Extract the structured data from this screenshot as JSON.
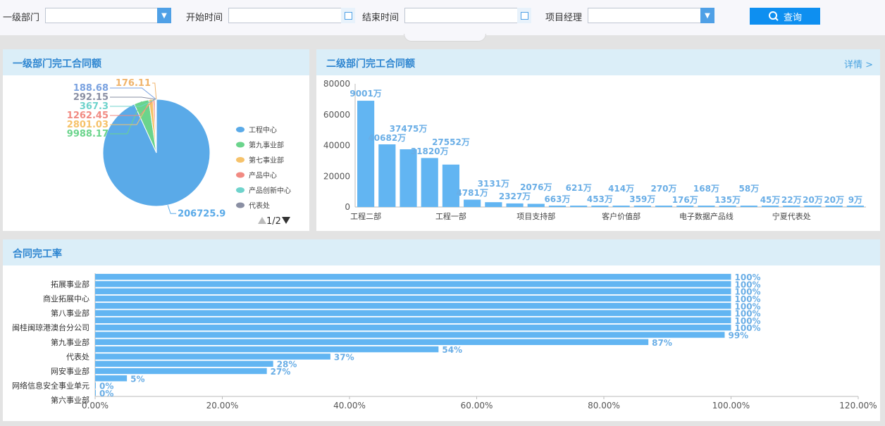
{
  "filters": {
    "dept_label": "一级部门",
    "start_label": "开始时间",
    "end_label": "结束时间",
    "pm_label": "项目经理",
    "search_label": "查询"
  },
  "panels": {
    "pie_title": "一级部门完工合同额",
    "bar_title": "二级部门完工合同额",
    "bar_detail": "详情 >",
    "rate_title": "合同完工率"
  },
  "colors": {
    "accent": "#0e8ff0",
    "pie_main": "#5aaae8",
    "bar": "#62b5f2",
    "header_bg": "#dbeef8"
  },
  "chart_data": [
    {
      "type": "pie",
      "title": "一级部门完工合同额",
      "slices": [
        {
          "label": "工程中心",
          "value": 206725.9,
          "color": "#5aaae8"
        },
        {
          "label": "第九事业部",
          "value": 9988.17,
          "color": "#6bd48c"
        },
        {
          "label": "第七事业部",
          "value": 2801.03,
          "color": "#f6c26a"
        },
        {
          "label": "产品中心",
          "value": 1262.45,
          "color": "#f18a82"
        },
        {
          "label": "产品创新中心",
          "value": 367.3,
          "color": "#6fd3cc"
        },
        {
          "label": "代表处",
          "value": 292.15,
          "color": "#8a8fa3"
        },
        {
          "label": "",
          "value": 188.68,
          "color": "#7aa2e0"
        },
        {
          "label": "",
          "value": 176.11,
          "color": "#f0b46c"
        }
      ],
      "value_labels": [
        "206725.9",
        "9988.17",
        "2801.03",
        "1262.45",
        "367.3",
        "292.15",
        "188.68",
        "176.11"
      ],
      "legend": [
        "工程中心",
        "第九事业部",
        "第七事业部",
        "产品中心",
        "产品创新中心",
        "代表处"
      ],
      "legend_page": "1/2"
    },
    {
      "type": "bar",
      "title": "二级部门完工合同额",
      "values": [
        69001,
        40682,
        37475,
        31820,
        27552,
        4781,
        3131,
        2327,
        2076,
        663,
        621,
        453,
        414,
        359,
        270,
        176,
        168,
        135,
        58,
        45,
        22,
        20,
        20,
        9
      ],
      "value_labels": [
        "9001万",
        "40682万",
        "37475万",
        "31820万",
        "27552万",
        "4781万",
        "3131万",
        "2327万",
        "2076万",
        "663万",
        "621万",
        "453万",
        "414万",
        "359万",
        "270万",
        "176万",
        "168万",
        "135万",
        "58万",
        "45万",
        "22万",
        "20万",
        "20万",
        "9万"
      ],
      "x_tick_labels": [
        "工程二部",
        "工程一部",
        "项目支持部",
        "客户价值部",
        "电子数据产品线",
        "宁夏代表处"
      ],
      "y_ticks": [
        "0",
        "20000",
        "40000",
        "60000",
        "80000"
      ],
      "ylim": [
        0,
        80000
      ]
    },
    {
      "type": "bar",
      "orientation": "horizontal",
      "title": "合同完工率",
      "values": [
        100,
        100,
        100,
        100,
        100,
        100,
        100,
        100,
        99,
        87,
        54,
        37,
        28,
        27,
        5,
        0,
        0
      ],
      "value_labels": [
        "100%",
        "100%",
        "100%",
        "100%",
        "100%",
        "100%",
        "100%",
        "100%",
        "99%",
        "87%",
        "54%",
        "37%",
        "28%",
        "27%",
        "5%",
        "0%",
        "0%"
      ],
      "y_tick_labels": [
        "拓展事业部",
        "商业拓展中心",
        "第八事业部",
        "闽桂闽琼港澳台分公司",
        "第九事业部",
        "代表处",
        "网安事业部",
        "网络信息安全事业单元",
        "第六事业部"
      ],
      "x_ticks": [
        "0.00%",
        "20.00%",
        "40.00%",
        "60.00%",
        "80.00%",
        "100.00%",
        "120.00%"
      ],
      "xlim": [
        0,
        120
      ]
    }
  ]
}
